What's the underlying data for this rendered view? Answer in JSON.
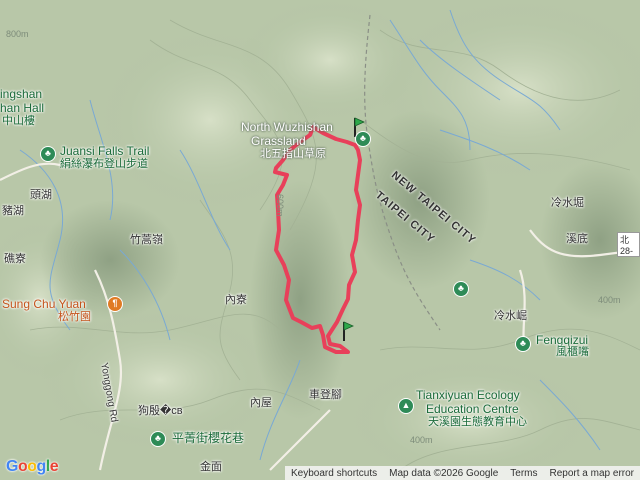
{
  "labels": {
    "north_wuzhishan_en": "North Wuzhishan",
    "grassland_en": "Grassland",
    "north_wuzhishan_zh": "北五指山草原",
    "new_taipei_city": "NEW TAIPEI CITY",
    "taipei_city": "TAIPEI CITY",
    "juansi_en": "Juansi Falls Trail",
    "juansi_zh": "絹絲瀑布登山步道",
    "jingshan_en_line1": "ingshan",
    "jingshan_en_line2": "han Hall",
    "jingshan_zh": "中山樓",
    "toufu": "頭湖",
    "zhuhu": "豬湖",
    "jianliao": "礁寮",
    "zhugaoling": "竹蒿嶺",
    "sung_chu_yuan_en": "Sung Chu Yuan",
    "sung_chu_yuan_zh": "松竹園",
    "yonggong_rd": "Yonggong Rd",
    "neiliao": "內寮",
    "goudianqu": "狗殷�св",
    "pingjing_zh": "平菁街櫻花巷",
    "jinmian": "金面",
    "neiwu": "內屋",
    "chedengjiao": "車登腳",
    "lengshuikeng_top": "冷水堀",
    "xidi": "溪底",
    "lengshuijue": "冷水崛",
    "fengqizui_en": "Fengqizui",
    "fengqizui_zh": "風櫃嘴",
    "tianxiyuan_en_line1": "Tianxiyuan Ecology",
    "tianxiyuan_en_line2": "Education Centre",
    "tianxiyuan_zh": "天溪園生態教育中心",
    "road_shield": "北28-",
    "c400_a": "400m",
    "c400_b": "400m",
    "c600": "600m",
    "c800": "800m"
  },
  "attribution": {
    "shortcuts": "Keyboard shortcuts",
    "map_data": "Map data ©2026 Google",
    "terms": "Terms",
    "report": "Report a map error"
  },
  "google_logo": [
    "G",
    "o",
    "o",
    "g",
    "l",
    "e"
  ],
  "colors": {
    "track": "#e8405a",
    "poi_green": "#2e8b57",
    "poi_orange": "#e07b24",
    "flag_green": "#2ea84a"
  }
}
